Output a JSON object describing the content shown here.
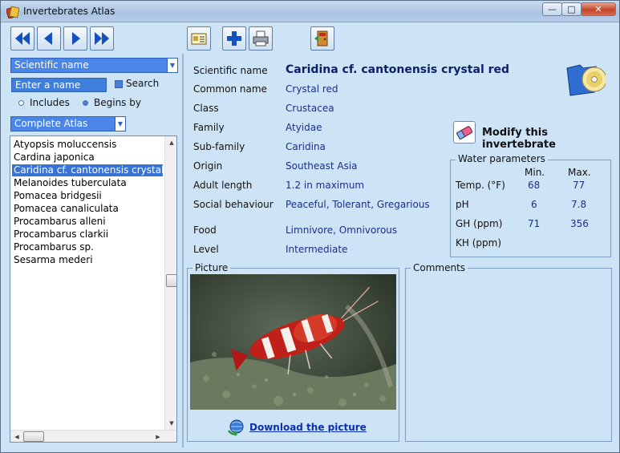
{
  "window": {
    "title": "Invertebrates Atlas",
    "controls": {
      "minimize": "—",
      "maximize": "□",
      "close": "✕"
    }
  },
  "toolbar": {
    "buttons": [
      {
        "name": "first-record-button",
        "icon": "double-arrow-left-icon"
      },
      {
        "name": "previous-record-button",
        "icon": "arrow-left-icon"
      },
      {
        "name": "next-record-button",
        "icon": "arrow-right-icon"
      },
      {
        "name": "last-record-button",
        "icon": "double-arrow-right-icon"
      },
      {
        "name": "card-view-button",
        "icon": "card-icon"
      },
      {
        "name": "add-button",
        "icon": "plus-icon"
      },
      {
        "name": "print-button",
        "icon": "printer-icon"
      },
      {
        "name": "exit-button",
        "icon": "exit-door-icon"
      }
    ]
  },
  "search": {
    "field_select": "Scientific name",
    "name_placeholder": "Enter a name",
    "search_label": "Search",
    "match_includes": "Includes",
    "match_begins_by": "Begins by",
    "match_selected": "Begins by",
    "atlas_select": "Complete Atlas"
  },
  "species_list": {
    "items": [
      "Atyopsis moluccensis",
      "Cardina japonica",
      "Caridina cf. cantonensis crystal red",
      "Melanoides tuberculata",
      "Pomacea bridgesii",
      "Pomacea canaliculata",
      "Procambarus alleni",
      "Procambarus clarkii",
      "Procambarus sp.",
      "Sesarma mederi"
    ],
    "selected_index": 2
  },
  "details": {
    "fields": [
      {
        "label": "Scientific name",
        "value": "Caridina cf. cantonensis crystal red"
      },
      {
        "label": "Common name",
        "value": "Crystal red"
      },
      {
        "label": "Class",
        "value": "Crustacea"
      },
      {
        "label": "Family",
        "value": "Atyidae"
      },
      {
        "label": "Sub-family",
        "value": "Caridina"
      },
      {
        "label": "Origin",
        "value": "Southeast Asia"
      },
      {
        "label": "Adult length",
        "value": "1.2 in maximum"
      },
      {
        "label": "Social behaviour",
        "value": "Peaceful, Tolerant, Gregarious"
      },
      {
        "label": "Food",
        "value": "Limnivore, Omnivorous"
      },
      {
        "label": "Level",
        "value": "Intermediate"
      }
    ],
    "modify_label": "Modify this invertebrate"
  },
  "water_parameters": {
    "title": "Water parameters",
    "min_header": "Min.",
    "max_header": "Max.",
    "rows": [
      {
        "label": "Temp. (°F)",
        "min": "68",
        "max": "77"
      },
      {
        "label": "pH",
        "min": "6",
        "max": "7.8"
      },
      {
        "label": "GH (ppm)",
        "min": "71",
        "max": "356"
      },
      {
        "label": "KH (ppm)",
        "min": "",
        "max": ""
      }
    ]
  },
  "picture": {
    "title": "Picture",
    "download_link": "Download the picture"
  },
  "comments": {
    "title": "Comments",
    "text": ""
  },
  "colors": {
    "window_bg": "#cde4f7",
    "selection": "#3874d6",
    "value_text": "#1a2e8a",
    "link": "#0d2fb3"
  }
}
